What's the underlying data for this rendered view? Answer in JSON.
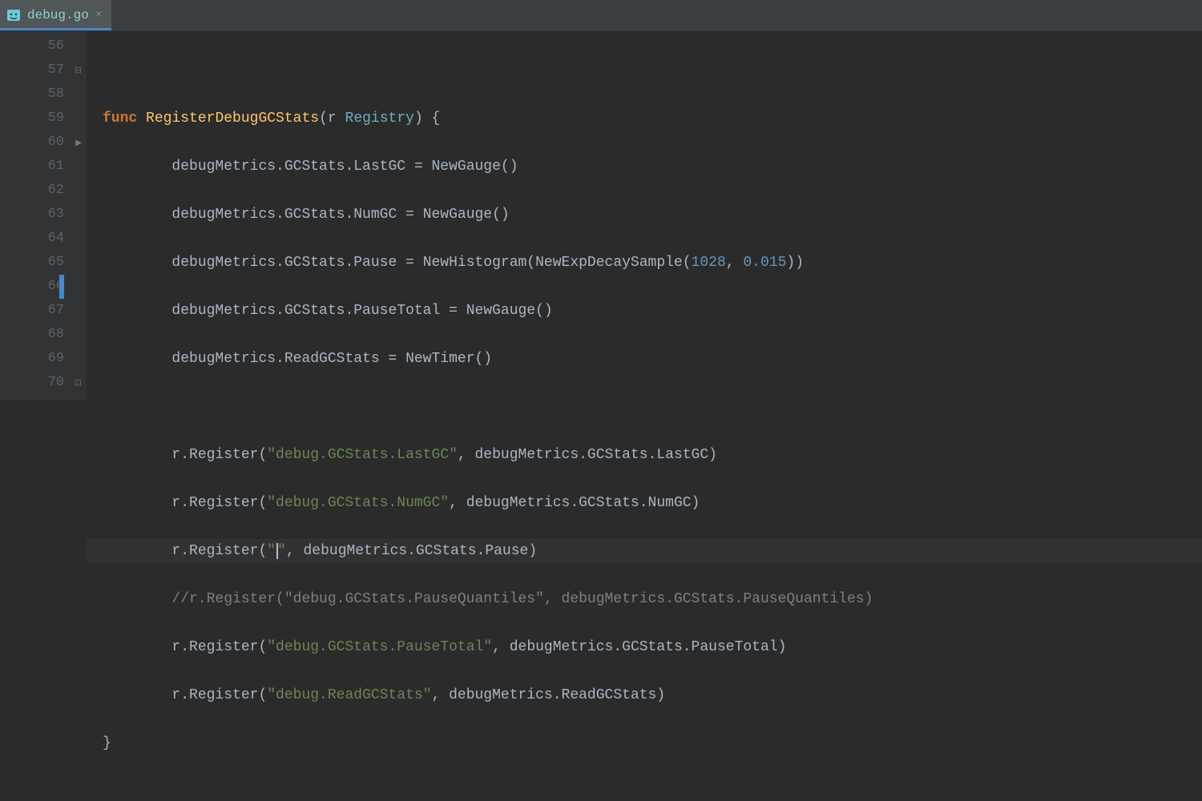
{
  "tab": {
    "filename": "debug.go",
    "close_glyph": "×"
  },
  "gutter": {
    "start": 56,
    "end": 70,
    "fold_start_line": 57,
    "fold_end_line": 70,
    "arrow_line": 60,
    "current_line": 66
  },
  "code": {
    "l56": "",
    "l57": {
      "kw": "func",
      "fn": "RegisterDebugGCStats",
      "param": "r",
      "type": "Registry",
      "brace": "{"
    },
    "l58": {
      "indent": "        ",
      "lhs": "debugMetrics.GCStats.LastGC",
      "eq": " = ",
      "rhs": "NewGauge()"
    },
    "l59": {
      "indent": "        ",
      "lhs": "debugMetrics.GCStats.NumGC",
      "eq": " = ",
      "rhs": "NewGauge()"
    },
    "l60": {
      "indent": "        ",
      "lhs": "debugMetrics.GCStats.Pause",
      "eq": " = ",
      "call": "NewHistogram(NewExpDecaySample(",
      "n1": "1028",
      "sep": ", ",
      "n2": "0.015",
      "close": "))"
    },
    "l61": {
      "indent": "        ",
      "lhs": "debugMetrics.GCStats.PauseTotal",
      "eq": " = ",
      "rhs": "NewGauge()"
    },
    "l62": {
      "indent": "        ",
      "lhs": "debugMetrics.ReadGCStats",
      "eq": " = ",
      "rhs": "NewTimer()"
    },
    "l63": "",
    "l64": {
      "indent": "        ",
      "recv": "r.Register(",
      "str": "\"debug.GCStats.LastGC\"",
      "sep": ", ",
      "arg": "debugMetrics.GCStats.LastGC)"
    },
    "l65": {
      "indent": "        ",
      "recv": "r.Register(",
      "str": "\"debug.GCStats.NumGC\"",
      "sep": ", ",
      "arg": "debugMetrics.GCStats.NumGC)"
    },
    "l66": {
      "indent": "        ",
      "recv": "r.Register(",
      "q1": "\"",
      "q2": "\"",
      "sep": ", ",
      "arg": "debugMetrics.GCStats.Pause)"
    },
    "l67": {
      "indent": "        ",
      "cmt": "//r.Register(\"debug.GCStats.PauseQuantiles\", debugMetrics.GCStats.PauseQuantiles)"
    },
    "l68": {
      "indent": "        ",
      "recv": "r.Register(",
      "str": "\"debug.GCStats.PauseTotal\"",
      "sep": ", ",
      "arg": "debugMetrics.GCStats.PauseTotal)"
    },
    "l69": {
      "indent": "        ",
      "recv": "r.Register(",
      "str": "\"debug.ReadGCStats\"",
      "sep": ", ",
      "arg": "debugMetrics.ReadGCStats)"
    },
    "l70": {
      "brace": "}"
    }
  }
}
